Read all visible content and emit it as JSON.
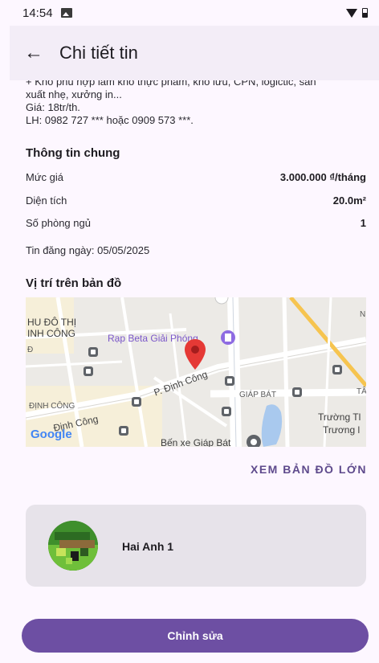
{
  "status_bar": {
    "time": "14:54"
  },
  "app_bar": {
    "title": "Chi tiết tin"
  },
  "description": {
    "lines": [
      "+ Kho phù hợp làm kho thực phẩm, kho lưu, CPN, logictic, sản",
      "xuất nhẹ, xưởng in...",
      "Giá: 18tr/th.",
      "LH: 0982 727 *** hoặc 0909 573 ***."
    ]
  },
  "general_info": {
    "title": "Thông tin chung",
    "rows": [
      {
        "label": "Mức giá",
        "value": "3.000.000 ₫/tháng"
      },
      {
        "label": "Diện tích",
        "value": "20.0m²"
      },
      {
        "label": "Số phòng ngủ",
        "value": "1"
      }
    ],
    "posted": "Tin đăng ngày: 05/05/2025"
  },
  "map_section": {
    "title": "Vị trí trên bản đồ",
    "labels": {
      "district1": "HU ĐÔ THỊ",
      "district2": "INH CÔNG",
      "cinema": "Rạp Beta Giải Phóng",
      "street": "P. Định Công",
      "street2": "Định Công",
      "area": "ĐỊNH CÔNG",
      "giap_bat": "GIÁP BÁT",
      "school1": "Trường Tl",
      "school2": "Trương l",
      "bus": "Bến xe Giáp Bát",
      "google": "Google",
      "ta": "TÂ",
      "n": "N",
      "d": "Đ"
    },
    "big_map_label": "XEM BẢN ĐỒ LỚN"
  },
  "owner": {
    "name": "Hai Anh 1"
  },
  "actions": {
    "edit_label": "Chỉnh sửa"
  },
  "colors": {
    "primary": "#6d4fa3",
    "background": "#fdf7ff",
    "app_bar": "#f3edf7",
    "card": "#e7e3ea",
    "pin": "#e53935"
  },
  "icons": {
    "back": "arrow-left-icon",
    "pin": "map-pin-icon",
    "status_image": "image-icon",
    "wifi": "wifi-icon",
    "battery": "battery-icon"
  }
}
